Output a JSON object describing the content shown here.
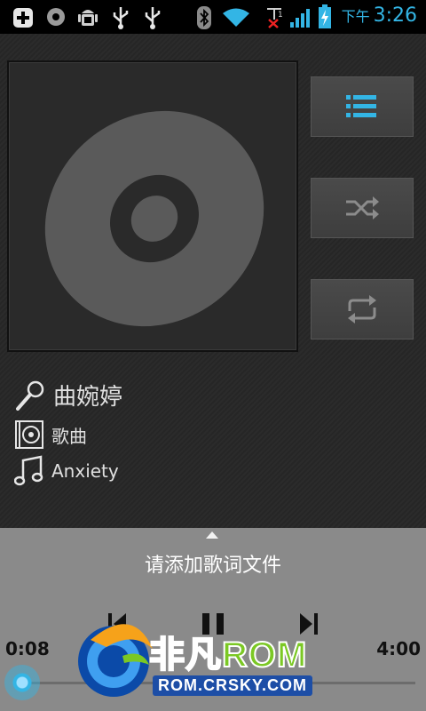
{
  "status_bar": {
    "time": "3:26",
    "ampm": "下午",
    "signal_badge": "1",
    "icons": [
      "plus-icon",
      "target-icon",
      "android-debug-icon",
      "usb-icon",
      "usb-icon",
      "bluetooth-icon",
      "wifi-icon",
      "no-sim-icon",
      "signal-icon",
      "battery-charging-icon"
    ],
    "accent_color": "#33b5e5"
  },
  "track": {
    "artist": "曲婉婷",
    "album": "歌曲",
    "title": "Anxiety"
  },
  "side_buttons": [
    "playlist-icon",
    "shuffle-icon",
    "repeat-icon"
  ],
  "lyrics": {
    "prompt": "请添加歌词文件"
  },
  "playback": {
    "elapsed": "0:08",
    "duration": "4:00",
    "progress_fraction": 0.033
  },
  "watermark": {
    "brand_cn": "非凡",
    "brand_en": "ROM",
    "url": "ROM.CRSKY.COM"
  }
}
